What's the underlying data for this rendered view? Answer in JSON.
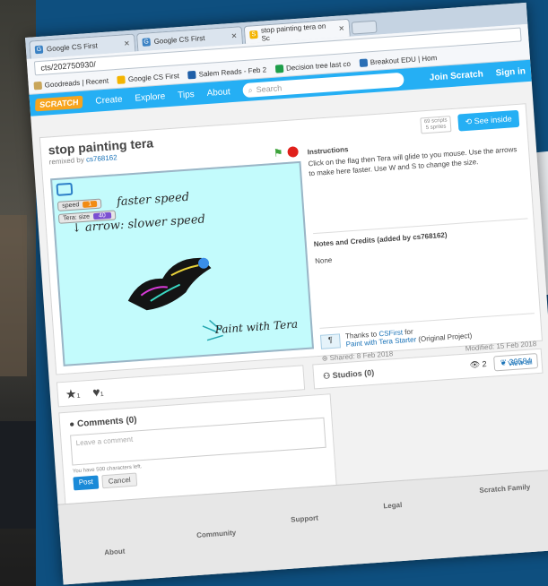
{
  "tabs": [
    {
      "label": "Google CS First",
      "icon": "google-icon"
    },
    {
      "label": "Google CS First",
      "icon": "google-icon"
    },
    {
      "label": "stop painting tera on Sc",
      "icon": "scratch-icon"
    }
  ],
  "url": "cts/202750930/",
  "bookmarks": [
    "Goodreads | Recent",
    "Google CS First",
    "Salem Reads - Feb 2",
    "Decision tree last co",
    "Breakout EDU | Hom"
  ],
  "nav": {
    "logo": "SCRATCH",
    "items": [
      "Create",
      "Explore",
      "Tips",
      "About"
    ],
    "search_placeholder": "Search",
    "join": "Join Scratch",
    "signin": "Sign in"
  },
  "project": {
    "title": "stop painting tera",
    "remixed_prefix": "remixed by",
    "remixed_user": "cs768162",
    "scripts_badge_line1": "69 scripts",
    "scripts_badge_line2": "5 sprites",
    "see_inside": "See inside",
    "stage": {
      "var_speed_label": "speed",
      "var_speed_value": "1",
      "var_size_label": "Tera: size",
      "var_size_value": "40",
      "hand_line1": "faster speed",
      "hand_line2": "↓ arrow: slower speed",
      "paint_label": "Paint with Tera"
    },
    "instructions_heading": "Instructions",
    "instructions": "Click on the flag then Tera will glide to you mouse. Use the arrows to make here faster. Use W and S to change the size.",
    "notes_heading": "Notes and Credits (added by cs768162)",
    "notes": "None",
    "credit_prefix": "Thanks to",
    "credit_user": "CSFirst",
    "credit_for": "for",
    "credit_project": "Paint with Tera Starter",
    "credit_suffix": "(Original Project)",
    "shared": "Shared: 8 Feb 2018",
    "modified": "Modified: 15 Feb 2018",
    "views": "2",
    "remixes": "30584"
  },
  "reactions": {
    "favorites": "1",
    "loves": "1"
  },
  "studios": {
    "title": "Studios (0)",
    "view_all": "View all"
  },
  "comments": {
    "title": "Comments (0)",
    "placeholder": "Leave a comment",
    "chars_left": "You have 500 characters left.",
    "post": "Post",
    "cancel": "Cancel"
  },
  "footer": [
    "About",
    "Community",
    "Support",
    "Legal",
    "Scratch Family"
  ]
}
